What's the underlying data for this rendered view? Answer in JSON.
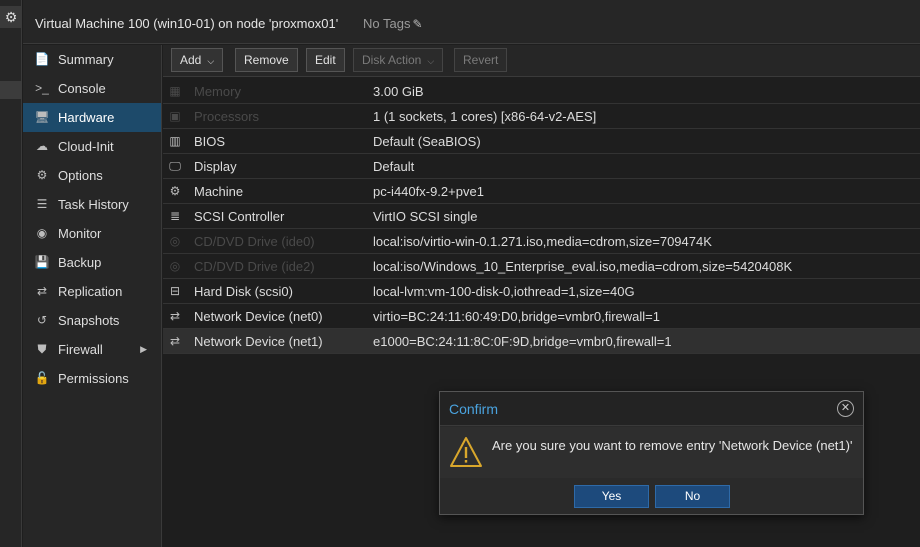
{
  "header": {
    "vm_title": "Virtual Machine 100 (win10-01) on node 'proxmox01'",
    "tags_label": "No Tags"
  },
  "nav": {
    "items": [
      {
        "label": "Summary",
        "icon": "summary-icon",
        "glyph": "📄"
      },
      {
        "label": "Console",
        "icon": "console-icon",
        "glyph": ">_"
      },
      {
        "label": "Hardware",
        "icon": "monitor-icon",
        "glyph": "🖥"
      },
      {
        "label": "Cloud-Init",
        "icon": "cloud-icon",
        "glyph": "☁"
      },
      {
        "label": "Options",
        "icon": "gear-icon",
        "glyph": "⚙"
      },
      {
        "label": "Task History",
        "icon": "list-icon",
        "glyph": "☰"
      },
      {
        "label": "Monitor",
        "icon": "eye-icon",
        "glyph": "◉"
      },
      {
        "label": "Backup",
        "icon": "floppy-icon",
        "glyph": "💾"
      },
      {
        "label": "Replication",
        "icon": "retweet-icon",
        "glyph": "⇄"
      },
      {
        "label": "Snapshots",
        "icon": "history-icon",
        "glyph": "↺"
      },
      {
        "label": "Firewall",
        "icon": "shield-icon",
        "glyph": "⛊"
      },
      {
        "label": "Permissions",
        "icon": "unlock-icon",
        "glyph": "🔓"
      }
    ],
    "active_index": 2
  },
  "toolbar": {
    "add_label": "Add",
    "remove_label": "Remove",
    "edit_label": "Edit",
    "disk_action_label": "Disk Action",
    "revert_label": "Revert"
  },
  "hardware": {
    "rows": [
      {
        "key": "Memory",
        "value": "3.00 GiB",
        "icon": "memory-icon",
        "glyph": "▦",
        "dim": true
      },
      {
        "key": "Processors",
        "value": "1 (1 sockets, 1 cores) [x86-64-v2-AES]",
        "icon": "cpu-icon",
        "glyph": "▣",
        "dim": true
      },
      {
        "key": "BIOS",
        "value": "Default (SeaBIOS)",
        "icon": "chip-icon",
        "glyph": "▥",
        "dim": false
      },
      {
        "key": "Display",
        "value": "Default",
        "icon": "desktop-icon",
        "glyph": "🖵",
        "dim": false
      },
      {
        "key": "Machine",
        "value": "pc-i440fx-9.2+pve1",
        "icon": "cogs-icon",
        "glyph": "⚙",
        "dim": false
      },
      {
        "key": "SCSI Controller",
        "value": "VirtIO SCSI single",
        "icon": "database-icon",
        "glyph": "≣",
        "dim": false
      },
      {
        "key": "CD/DVD Drive (ide0)",
        "value": "local:iso/virtio-win-0.1.271.iso,media=cdrom,size=709474K",
        "icon": "cdrom-icon",
        "glyph": "◎",
        "dim": true
      },
      {
        "key": "CD/DVD Drive (ide2)",
        "value": "local:iso/Windows_10_Enterprise_eval.iso,media=cdrom,size=5420408K",
        "icon": "cdrom-icon",
        "glyph": "◎",
        "dim": true
      },
      {
        "key": "Hard Disk (scsi0)",
        "value": "local-lvm:vm-100-disk-0,iothread=1,size=40G",
        "icon": "hdd-icon",
        "glyph": "⊟",
        "dim": false
      },
      {
        "key": "Network Device (net0)",
        "value": "virtio=BC:24:11:60:49:D0,bridge=vmbr0,firewall=1",
        "icon": "exchange-icon",
        "glyph": "⇄",
        "dim": false
      },
      {
        "key": "Network Device (net1)",
        "value": "e1000=BC:24:11:8C:0F:9D,bridge=vmbr0,firewall=1",
        "icon": "exchange-icon",
        "glyph": "⇄",
        "dim": false
      }
    ],
    "selected_index": 10
  },
  "dialog": {
    "title": "Confirm",
    "message": "Are you sure you want to remove entry 'Network Device (net1)'",
    "yes_label": "Yes",
    "no_label": "No",
    "title_color": "#4aa3df"
  }
}
